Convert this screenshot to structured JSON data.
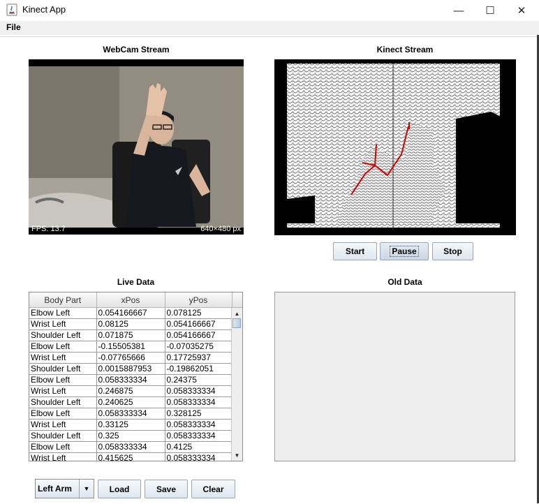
{
  "window": {
    "title": "Kinect App",
    "minimize_glyph": "—",
    "maximize_glyph": "☐",
    "close_glyph": "✕"
  },
  "menu": {
    "file_label": "File"
  },
  "webcam": {
    "title": "WebCam Stream",
    "fps_text": "FPS: 13.7",
    "resolution_text": "640×480 px"
  },
  "kinect": {
    "title": "Kinect Stream"
  },
  "controls": {
    "start_label": "Start",
    "pause_label": "Pause",
    "stop_label": "Stop"
  },
  "live_data": {
    "title": "Live Data",
    "columns": [
      "Body Part",
      "xPos",
      "yPos"
    ],
    "rows": [
      [
        "Elbow Left",
        "0.054166667",
        "0.078125"
      ],
      [
        "Wrist Left",
        "0.08125",
        "0.054166667"
      ],
      [
        "Shoulder Left",
        "0.071875",
        "0.054166667"
      ],
      [
        "Elbow Left",
        "-0.15505381",
        "-0.07035275"
      ],
      [
        "Wrist Left",
        "-0.07765666",
        "0.17725937"
      ],
      [
        "Shoulder Left",
        "0.0015887953",
        "-0.19862051"
      ],
      [
        "Elbow Left",
        "0.058333334",
        "0.24375"
      ],
      [
        "Wrist Left",
        "0.246875",
        "0.058333334"
      ],
      [
        "Shoulder Left",
        "0.240625",
        "0.058333334"
      ],
      [
        "Elbow Left",
        "0.058333334",
        "0.328125"
      ],
      [
        "Wrist Left",
        "0.33125",
        "0.058333334"
      ],
      [
        "Shoulder Left",
        "0.325",
        "0.058333334"
      ],
      [
        "Elbow Left",
        "0.058333334",
        "0.4125"
      ],
      [
        "Wrist Left",
        "0.415625",
        "0.058333334"
      ]
    ],
    "scroll_up_glyph": "▲",
    "scroll_down_glyph": "▼"
  },
  "old_data": {
    "title": "Old Data"
  },
  "bottom": {
    "selected_part": "Left Arm",
    "dropdown_glyph": "▼",
    "load_label": "Load",
    "save_label": "Save",
    "clear_label": "Clear"
  }
}
